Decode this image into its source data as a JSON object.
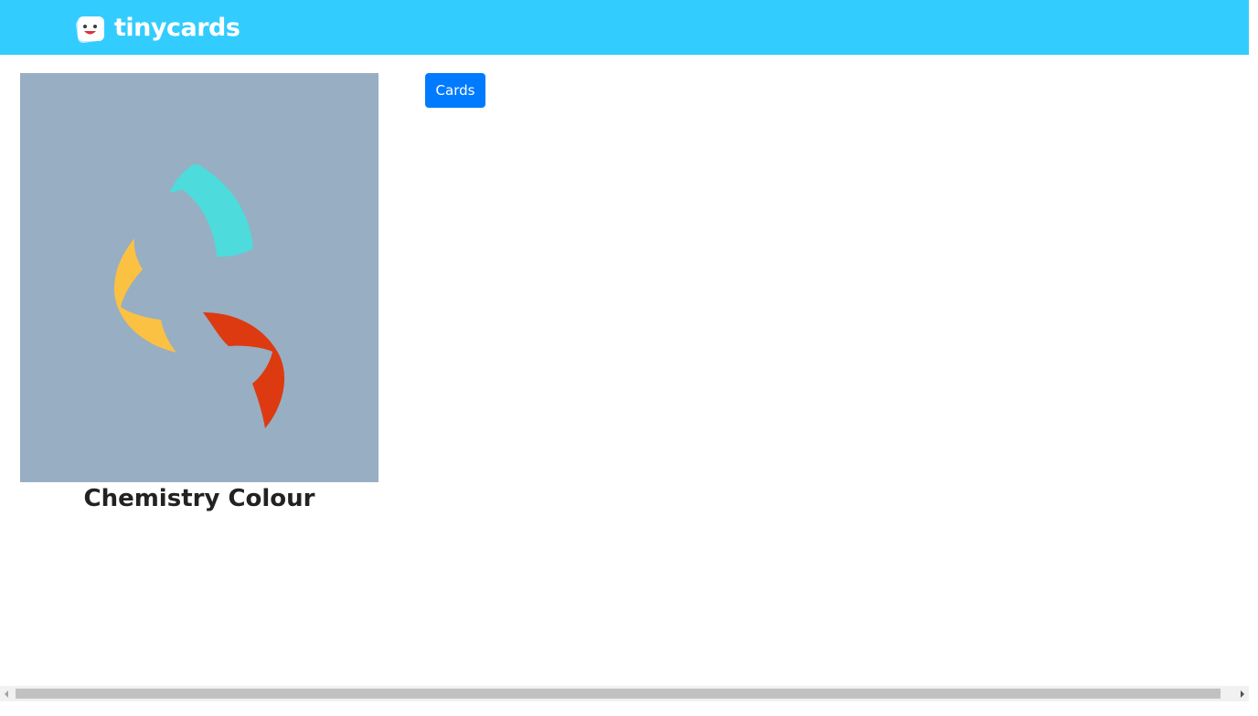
{
  "header": {
    "brand_name": "tinycards",
    "background_color": "#33ccff",
    "logo_icon": "tinycards-face-logo-icon"
  },
  "deck": {
    "title": "Chemistry Colour",
    "image_background": "#98aec2",
    "image_icon": "chemistry-arcs-icon",
    "arc_colors": [
      "#4ddbdb",
      "#fbc143",
      "#dd3a12"
    ]
  },
  "actions": {
    "cards_label": "Cards",
    "cards_color": "#007bff"
  }
}
